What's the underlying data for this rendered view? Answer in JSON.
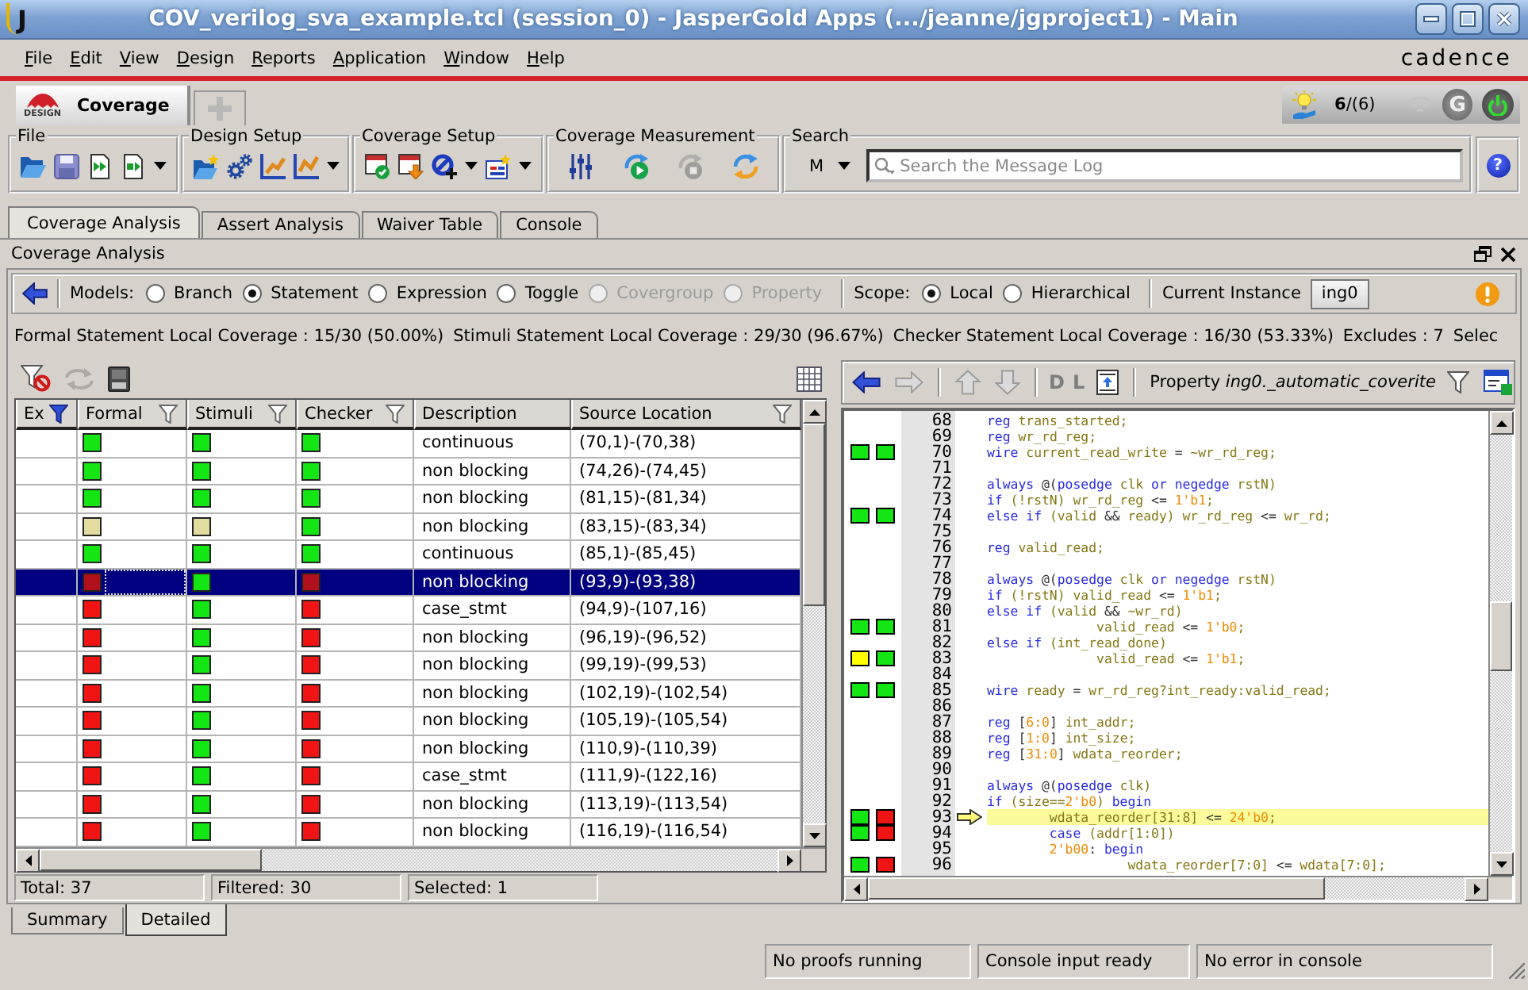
{
  "window": {
    "logo": "J",
    "title": "COV_verilog_sva_example.tcl (session_0) - JasperGold Apps (.../jeanne/jgproject1) - Main"
  },
  "menu": [
    "File",
    "Edit",
    "View",
    "Design",
    "Reports",
    "Application",
    "Window",
    "Help"
  ],
  "brand": "cadence",
  "perspectives": [
    {
      "kind": "page",
      "label": "Coverage",
      "badge": "DESIGN",
      "selected": true
    },
    {
      "kind": "add",
      "selected": false
    }
  ],
  "tray": {
    "jobs": "**6**/(6)",
    "g": "G"
  },
  "toolbar": [
    {
      "title": "File",
      "tools": [
        {
          "dropdown": false,
          "disabled": false
        },
        {
          "dropdown": false,
          "disabled": false
        },
        {
          "dropdown": false,
          "disabled": false
        },
        {
          "dropdown": true,
          "disabled": false
        }
      ]
    },
    {
      "title": "Design Setup",
      "tools": [
        {
          "dropdown": false,
          "disabled": false
        },
        {
          "dropdown": false,
          "disabled": false
        },
        {
          "dropdown": false,
          "disabled": false
        },
        {
          "dropdown": true,
          "disabled": false
        }
      ]
    },
    {
      "title": "Coverage Setup",
      "tools": [
        {
          "dropdown": false,
          "disabled": false
        },
        {
          "dropdown": false,
          "disabled": false
        },
        {
          "dropdown": true,
          "disabled": false
        },
        {
          "dropdown": true,
          "disabled": false
        }
      ]
    },
    {
      "title": "Coverage Measurement",
      "tools": [
        {
          "dropdown": false,
          "disabled": false
        },
        {
          "dropdown": false,
          "disabled": false
        },
        {
          "dropdown": false,
          "disabled": true
        },
        {
          "dropdown": false,
          "disabled": false
        }
      ]
    }
  ],
  "search": {
    "title": "Search",
    "mode": "M",
    "placeholder": "Search the Message Log"
  },
  "help": "?",
  "tabs": [
    {
      "label": "Coverage Analysis",
      "selected": true
    },
    {
      "label": "Assert Analysis",
      "selected": false
    },
    {
      "label": "Waiver Table",
      "selected": false
    },
    {
      "label": "Console",
      "selected": false
    }
  ],
  "panel": {
    "title": "Coverage Analysis",
    "models_label": "Models:",
    "models": [
      {
        "label": "Branch",
        "selected": false,
        "disabled": false
      },
      {
        "label": "Statement",
        "selected": true,
        "disabled": false
      },
      {
        "label": "Expression",
        "selected": false,
        "disabled": false
      },
      {
        "label": "Toggle",
        "selected": false,
        "disabled": false
      },
      {
        "label": "Covergroup",
        "selected": false,
        "disabled": true
      },
      {
        "label": "Property",
        "selected": false,
        "disabled": true
      }
    ],
    "scope_label": "Scope:",
    "scopes": [
      {
        "label": "Local",
        "selected": true
      },
      {
        "label": "Hierarchical",
        "selected": false
      }
    ],
    "instance_label": "Current Instance",
    "instance": "ing0",
    "summary": [
      "Formal Statement Local Coverage : 15/30 (50.00%)",
      "Stimuli Statement Local Coverage : 29/30 (96.67%)",
      "Checker Statement Local Coverage : 16/30 (53.33%)",
      "Excludes : 7",
      "Selec"
    ]
  },
  "table": {
    "tools": [
      {
        "disabled": false
      },
      {
        "disabled": true
      },
      {
        "disabled": false
      },
      {
        "disabled": false
      }
    ],
    "columns": [
      {
        "label": "Ex",
        "kind": "filter",
        "filtered": true
      },
      {
        "label": "Formal",
        "kind": "filter",
        "filtered": false
      },
      {
        "label": "Stimuli",
        "kind": "filter",
        "filtered": false
      },
      {
        "label": "Checker",
        "kind": "filter",
        "filtered": false
      },
      {
        "label": "Description",
        "kind": "plain"
      },
      {
        "label": "Source Location",
        "kind": "filter",
        "filtered": false
      }
    ],
    "rows": [
      {
        "formal": {
          "color": "#14e614"
        },
        "stimuli": {
          "color": "#14e614"
        },
        "checker": {
          "color": "#14e614"
        },
        "description": "continuous",
        "location": "(70,1)-(70,38)",
        "selected": false,
        "focused": false
      },
      {
        "formal": {
          "color": "#14e614"
        },
        "stimuli": {
          "color": "#14e614"
        },
        "checker": {
          "color": "#14e614"
        },
        "description": "non blocking",
        "location": "(74,26)-(74,45)",
        "selected": false,
        "focused": false
      },
      {
        "formal": {
          "color": "#14e614"
        },
        "stimuli": {
          "color": "#14e614"
        },
        "checker": {
          "color": "#14e614"
        },
        "description": "non blocking",
        "location": "(81,15)-(81,34)",
        "selected": false,
        "focused": false
      },
      {
        "formal": {
          "color": "#e3dca0"
        },
        "stimuli": {
          "color": "#e3dca0"
        },
        "checker": {
          "color": "#14e614"
        },
        "description": "non blocking",
        "location": "(83,15)-(83,34)",
        "selected": false,
        "focused": false
      },
      {
        "formal": {
          "color": "#14e614"
        },
        "stimuli": {
          "color": "#14e614"
        },
        "checker": {
          "color": "#14e614"
        },
        "description": "continuous",
        "location": "(85,1)-(85,45)",
        "selected": false,
        "focused": false
      },
      {
        "formal": {
          "color": "#b0101c"
        },
        "stimuli": {
          "color": "#14e614"
        },
        "checker": {
          "color": "#b0101c"
        },
        "description": "non blocking",
        "location": "(93,9)-(93,38)",
        "selected": true,
        "focused": true
      },
      {
        "formal": {
          "color": "#f01414"
        },
        "stimuli": {
          "color": "#14e614"
        },
        "checker": {
          "color": "#f01414"
        },
        "description": "case_stmt",
        "location": "(94,9)-(107,16)",
        "selected": false,
        "focused": false
      },
      {
        "formal": {
          "color": "#f01414"
        },
        "stimuli": {
          "color": "#14e614"
        },
        "checker": {
          "color": "#f01414"
        },
        "description": "non blocking",
        "location": "(96,19)-(96,52)",
        "selected": false,
        "focused": false
      },
      {
        "formal": {
          "color": "#f01414"
        },
        "stimuli": {
          "color": "#14e614"
        },
        "checker": {
          "color": "#f01414"
        },
        "description": "non blocking",
        "location": "(99,19)-(99,53)",
        "selected": false,
        "focused": false
      },
      {
        "formal": {
          "color": "#f01414"
        },
        "stimuli": {
          "color": "#14e614"
        },
        "checker": {
          "color": "#f01414"
        },
        "description": "non blocking",
        "location": "(102,19)-(102,54)",
        "selected": false,
        "focused": false
      },
      {
        "formal": {
          "color": "#f01414"
        },
        "stimuli": {
          "color": "#14e614"
        },
        "checker": {
          "color": "#f01414"
        },
        "description": "non blocking",
        "location": "(105,19)-(105,54)",
        "selected": false,
        "focused": false
      },
      {
        "formal": {
          "color": "#f01414"
        },
        "stimuli": {
          "color": "#14e614"
        },
        "checker": {
          "color": "#f01414"
        },
        "description": "non blocking",
        "location": "(110,9)-(110,39)",
        "selected": false,
        "focused": false
      },
      {
        "formal": {
          "color": "#f01414"
        },
        "stimuli": {
          "color": "#14e614"
        },
        "checker": {
          "color": "#f01414"
        },
        "description": "case_stmt",
        "location": "(111,9)-(122,16)",
        "selected": false,
        "focused": false
      },
      {
        "formal": {
          "color": "#f01414"
        },
        "stimuli": {
          "color": "#14e614"
        },
        "checker": {
          "color": "#f01414"
        },
        "description": "non blocking",
        "location": "(113,19)-(113,54)",
        "selected": false,
        "focused": false
      },
      {
        "formal": {
          "color": "#f01414"
        },
        "stimuli": {
          "color": "#14e614"
        },
        "checker": {
          "color": "#f01414"
        },
        "description": "non blocking",
        "location": "(116,19)-(116,54)",
        "selected": false,
        "focused": false
      }
    ],
    "status": [
      "Total: 37",
      "Filtered: 30",
      "Selected: 1"
    ]
  },
  "source": {
    "nav": [
      {
        "disabled": false
      },
      {
        "disabled": true
      }
    ],
    "steps": [
      {
        "disabled": true
      },
      {
        "disabled": true
      }
    ],
    "letters": [
      {
        "label": "D",
        "disabled": true
      },
      {
        "label": "L",
        "disabled": true
      }
    ],
    "property": "Property *ing0._automatic_coverite*",
    "lines": [
      {
        "number": "68",
        "current": false,
        "tokens": [
          {
            "kind": "kw",
            "text": "reg"
          },
          {
            "kind": "id",
            "text": " trans_started;"
          }
        ]
      },
      {
        "number": "69",
        "current": false,
        "tokens": [
          {
            "kind": "kw",
            "text": "reg"
          },
          {
            "kind": "id",
            "text": " wr_rd_reg;"
          }
        ]
      },
      {
        "number": "70",
        "current": false,
        "markers": [
          {
            "color": "#14e614"
          },
          {
            "color": "#14e614"
          }
        ],
        "tokens": [
          {
            "kind": "kw",
            "text": "wire"
          },
          {
            "kind": "id",
            "text": " current_read_write "
          },
          {
            "kind": "op",
            "text": "="
          },
          {
            "kind": "id",
            "text": " ~wr_rd_reg;"
          }
        ]
      },
      {
        "number": "71",
        "current": false
      },
      {
        "number": "72",
        "current": false,
        "tokens": [
          {
            "kind": "kw",
            "text": "always"
          },
          {
            "kind": "op",
            "text": " @("
          },
          {
            "kind": "kw",
            "text": "posedge"
          },
          {
            "kind": "id",
            "text": " clk "
          },
          {
            "kind": "kw",
            "text": "or negedge"
          },
          {
            "kind": "id",
            "text": " rstN)"
          }
        ]
      },
      {
        "number": "73",
        "current": false,
        "tokens": [
          {
            "kind": "kw",
            "text": "if"
          },
          {
            "kind": "id",
            "text": " (!rstN) wr_rd_reg "
          },
          {
            "kind": "op",
            "text": "<="
          },
          {
            "kind": "num",
            "text": " 1'b1"
          },
          {
            "kind": "id",
            "text": ";"
          }
        ]
      },
      {
        "number": "74",
        "current": false,
        "markers": [
          {
            "color": "#14e614"
          },
          {
            "color": "#14e614"
          }
        ],
        "tokens": [
          {
            "kind": "kw",
            "text": "else if"
          },
          {
            "kind": "id",
            "text": " (valid "
          },
          {
            "kind": "op",
            "text": "&&"
          },
          {
            "kind": "id",
            "text": " ready) wr_rd_reg "
          },
          {
            "kind": "op",
            "text": "<="
          },
          {
            "kind": "id",
            "text": " wr_rd;"
          }
        ]
      },
      {
        "number": "75",
        "current": false
      },
      {
        "number": "76",
        "current": false,
        "tokens": [
          {
            "kind": "kw",
            "text": "reg"
          },
          {
            "kind": "id",
            "text": " valid_read;"
          }
        ]
      },
      {
        "number": "77",
        "current": false
      },
      {
        "number": "78",
        "current": false,
        "tokens": [
          {
            "kind": "kw",
            "text": "always"
          },
          {
            "kind": "op",
            "text": " @("
          },
          {
            "kind": "kw",
            "text": "posedge"
          },
          {
            "kind": "id",
            "text": " clk "
          },
          {
            "kind": "kw",
            "text": "or negedge"
          },
          {
            "kind": "id",
            "text": " rstN)"
          }
        ]
      },
      {
        "number": "79",
        "current": false,
        "tokens": [
          {
            "kind": "kw",
            "text": "if"
          },
          {
            "kind": "id",
            "text": " (!rstN) valid_read "
          },
          {
            "kind": "op",
            "text": "<="
          },
          {
            "kind": "num",
            "text": " 1'b1"
          },
          {
            "kind": "id",
            "text": ";"
          }
        ]
      },
      {
        "number": "80",
        "current": false,
        "tokens": [
          {
            "kind": "kw",
            "text": "else if"
          },
          {
            "kind": "id",
            "text": " (valid "
          },
          {
            "kind": "op",
            "text": "&&"
          },
          {
            "kind": "id",
            "text": " ~wr_rd)"
          }
        ]
      },
      {
        "number": "81",
        "current": false,
        "markers": [
          {
            "color": "#14e614"
          },
          {
            "color": "#14e614"
          }
        ],
        "tokens": [
          {
            "kind": "id",
            "text": "              valid_read "
          },
          {
            "kind": "op",
            "text": "<="
          },
          {
            "kind": "num",
            "text": " 1'b0"
          },
          {
            "kind": "id",
            "text": ";"
          }
        ]
      },
      {
        "number": "82",
        "current": false,
        "tokens": [
          {
            "kind": "kw",
            "text": "else if"
          },
          {
            "kind": "id",
            "text": " (int_read_done)"
          }
        ]
      },
      {
        "number": "83",
        "current": false,
        "markers": [
          {
            "color": "#ffff00"
          },
          {
            "color": "#14e614"
          }
        ],
        "tokens": [
          {
            "kind": "id",
            "text": "              valid_read "
          },
          {
            "kind": "op",
            "text": "<="
          },
          {
            "kind": "num",
            "text": " 1'b1"
          },
          {
            "kind": "id",
            "text": ";"
          }
        ]
      },
      {
        "number": "84",
        "current": false
      },
      {
        "number": "85",
        "current": false,
        "markers": [
          {
            "color": "#14e614"
          },
          {
            "color": "#14e614"
          }
        ],
        "tokens": [
          {
            "kind": "kw",
            "text": "wire"
          },
          {
            "kind": "id",
            "text": " ready "
          },
          {
            "kind": "op",
            "text": "="
          },
          {
            "kind": "id",
            "text": " wr_rd_reg?int_ready:valid_read;"
          }
        ]
      },
      {
        "number": "86",
        "current": false
      },
      {
        "number": "87",
        "current": false,
        "tokens": [
          {
            "kind": "kw",
            "text": "reg"
          },
          {
            "kind": "op",
            "text": " ["
          },
          {
            "kind": "num",
            "text": "6:0"
          },
          {
            "kind": "op",
            "text": "]"
          },
          {
            "kind": "id",
            "text": " int_addr;"
          }
        ]
      },
      {
        "number": "88",
        "current": false,
        "tokens": [
          {
            "kind": "kw",
            "text": "reg"
          },
          {
            "kind": "op",
            "text": " ["
          },
          {
            "kind": "num",
            "text": "1:0"
          },
          {
            "kind": "op",
            "text": "]"
          },
          {
            "kind": "id",
            "text": " int_size;"
          }
        ]
      },
      {
        "number": "89",
        "current": false,
        "tokens": [
          {
            "kind": "kw",
            "text": "reg"
          },
          {
            "kind": "op",
            "text": " ["
          },
          {
            "kind": "num",
            "text": "31:0"
          },
          {
            "kind": "op",
            "text": "]"
          },
          {
            "kind": "id",
            "text": " wdata_reorder;"
          }
        ]
      },
      {
        "number": "90",
        "current": false
      },
      {
        "number": "91",
        "current": false,
        "tokens": [
          {
            "kind": "kw",
            "text": "always"
          },
          {
            "kind": "op",
            "text": " @("
          },
          {
            "kind": "kw",
            "text": "posedge"
          },
          {
            "kind": "id",
            "text": " clk)"
          }
        ]
      },
      {
        "number": "92",
        "current": false,
        "tokens": [
          {
            "kind": "kw",
            "text": "if"
          },
          {
            "kind": "id",
            "text": " (size=="
          },
          {
            "kind": "num",
            "text": "2'b0"
          },
          {
            "kind": "id",
            "text": ")"
          },
          {
            "kind": "kw",
            "text": " begin"
          }
        ]
      },
      {
        "number": "93",
        "current": true,
        "markers": [
          {
            "color": "#14e614"
          },
          {
            "color": "#f01414"
          }
        ],
        "tokens": [
          {
            "kind": "id",
            "text": "        wdata_reorder[31:8] "
          },
          {
            "kind": "op",
            "text": "<="
          },
          {
            "kind": "num",
            "text": " 24'b0"
          },
          {
            "kind": "id",
            "text": ";"
          }
        ]
      },
      {
        "number": "94",
        "current": false,
        "markers": [
          {
            "color": "#14e614"
          },
          {
            "color": "#f01414"
          }
        ],
        "tokens": [
          {
            "kind": "kw",
            "text": "        case"
          },
          {
            "kind": "id",
            "text": " (addr[1:0])"
          }
        ]
      },
      {
        "number": "95",
        "current": false,
        "tokens": [
          {
            "kind": "num",
            "text": "        2'b00"
          },
          {
            "kind": "op",
            "text": ":"
          },
          {
            "kind": "kw",
            "text": " begin"
          }
        ]
      },
      {
        "number": "96",
        "current": false,
        "markers": [
          {
            "color": "#14e614"
          },
          {
            "color": "#f01414"
          }
        ],
        "tokens": [
          {
            "kind": "id",
            "text": "                  wdata_reorder[7:0] "
          },
          {
            "kind": "op",
            "text": "<="
          },
          {
            "kind": "id",
            "text": " wdata[7:0];"
          }
        ]
      }
    ]
  },
  "bottom_tabs": [
    {
      "label": "Summary",
      "selected": false
    },
    {
      "label": "Detailed",
      "selected": true
    }
  ],
  "status_bar": [
    "No proofs running",
    "Console input ready",
    "No error in console"
  ]
}
